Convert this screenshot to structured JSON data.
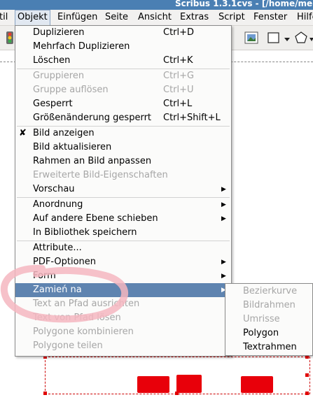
{
  "window": {
    "title": "Scribus 1.3.1cvs - [/home/me"
  },
  "menubar": [
    {
      "label": "til",
      "active": false
    },
    {
      "label": "Objekt",
      "active": true
    },
    {
      "label": "Einfügen",
      "active": false
    },
    {
      "label": "Seite",
      "active": false
    },
    {
      "label": "Ansicht",
      "active": false
    },
    {
      "label": "Extras",
      "active": false
    },
    {
      "label": "Script",
      "active": false
    },
    {
      "label": "Fenster",
      "active": false
    },
    {
      "label": "Hilfe",
      "active": false
    }
  ],
  "menu": {
    "items": [
      {
        "label": "Duplizieren",
        "shortcut": "Ctrl+D",
        "disabled": false
      },
      {
        "label": "Mehrfach Duplizieren",
        "shortcut": "",
        "disabled": false
      },
      {
        "label": "Löschen",
        "shortcut": "Ctrl+K",
        "disabled": false
      },
      {
        "label": "Gruppieren",
        "shortcut": "Ctrl+G",
        "disabled": true
      },
      {
        "label": "Gruppe auflösen",
        "shortcut": "Ctrl+U",
        "disabled": true
      },
      {
        "label": "Gesperrt",
        "shortcut": "Ctrl+L",
        "disabled": false
      },
      {
        "label": "Größenänderung gesperrt",
        "shortcut": "Ctrl+Shift+L",
        "disabled": false
      },
      {
        "label": "Bild anzeigen",
        "shortcut": "",
        "disabled": false,
        "checked": true
      },
      {
        "label": "Bild aktualisieren",
        "shortcut": "",
        "disabled": false
      },
      {
        "label": "Rahmen an Bild anpassen",
        "shortcut": "",
        "disabled": false
      },
      {
        "label": "Erweiterte Bild-Eigenschaften",
        "shortcut": "",
        "disabled": true
      },
      {
        "label": "Vorschau",
        "shortcut": "",
        "disabled": false,
        "submenu": true
      },
      {
        "label": "Anordnung",
        "shortcut": "",
        "disabled": false,
        "submenu": true
      },
      {
        "label": "Auf andere Ebene schieben",
        "shortcut": "",
        "disabled": false,
        "submenu": true
      },
      {
        "label": "In Bibliothek speichern",
        "shortcut": "",
        "disabled": false
      },
      {
        "label": "Attribute...",
        "shortcut": "",
        "disabled": false
      },
      {
        "label": "PDF-Optionen",
        "shortcut": "",
        "disabled": false,
        "submenu": true
      },
      {
        "label": "Form",
        "shortcut": "",
        "disabled": false,
        "submenu": true
      },
      {
        "label": "Zamień na",
        "shortcut": "",
        "disabled": false,
        "submenu": true,
        "highlighted": true
      },
      {
        "label": "Text an Pfad ausrichten",
        "shortcut": "",
        "disabled": true
      },
      {
        "label": "Text von Pfad lösen",
        "shortcut": "",
        "disabled": true
      },
      {
        "label": "Polygone kombinieren",
        "shortcut": "",
        "disabled": true
      },
      {
        "label": "Polygone teilen",
        "shortcut": "",
        "disabled": true
      }
    ]
  },
  "submenu": {
    "items": [
      {
        "label": "Bezierkurve",
        "disabled": true
      },
      {
        "label": "Bildrahmen",
        "disabled": true
      },
      {
        "label": "Umrisse",
        "disabled": true
      },
      {
        "label": "Polygon",
        "disabled": false
      },
      {
        "label": "Textrahmen",
        "disabled": false
      }
    ]
  },
  "icons": {
    "check": "checkmark-icon",
    "arrow": "submenu-arrow-icon"
  },
  "colors": {
    "highlight": "#5f84b0",
    "disabled_text": "#a6a6a6",
    "annotation": "#f4b6c0",
    "title_bar": "#4a7fb3"
  }
}
